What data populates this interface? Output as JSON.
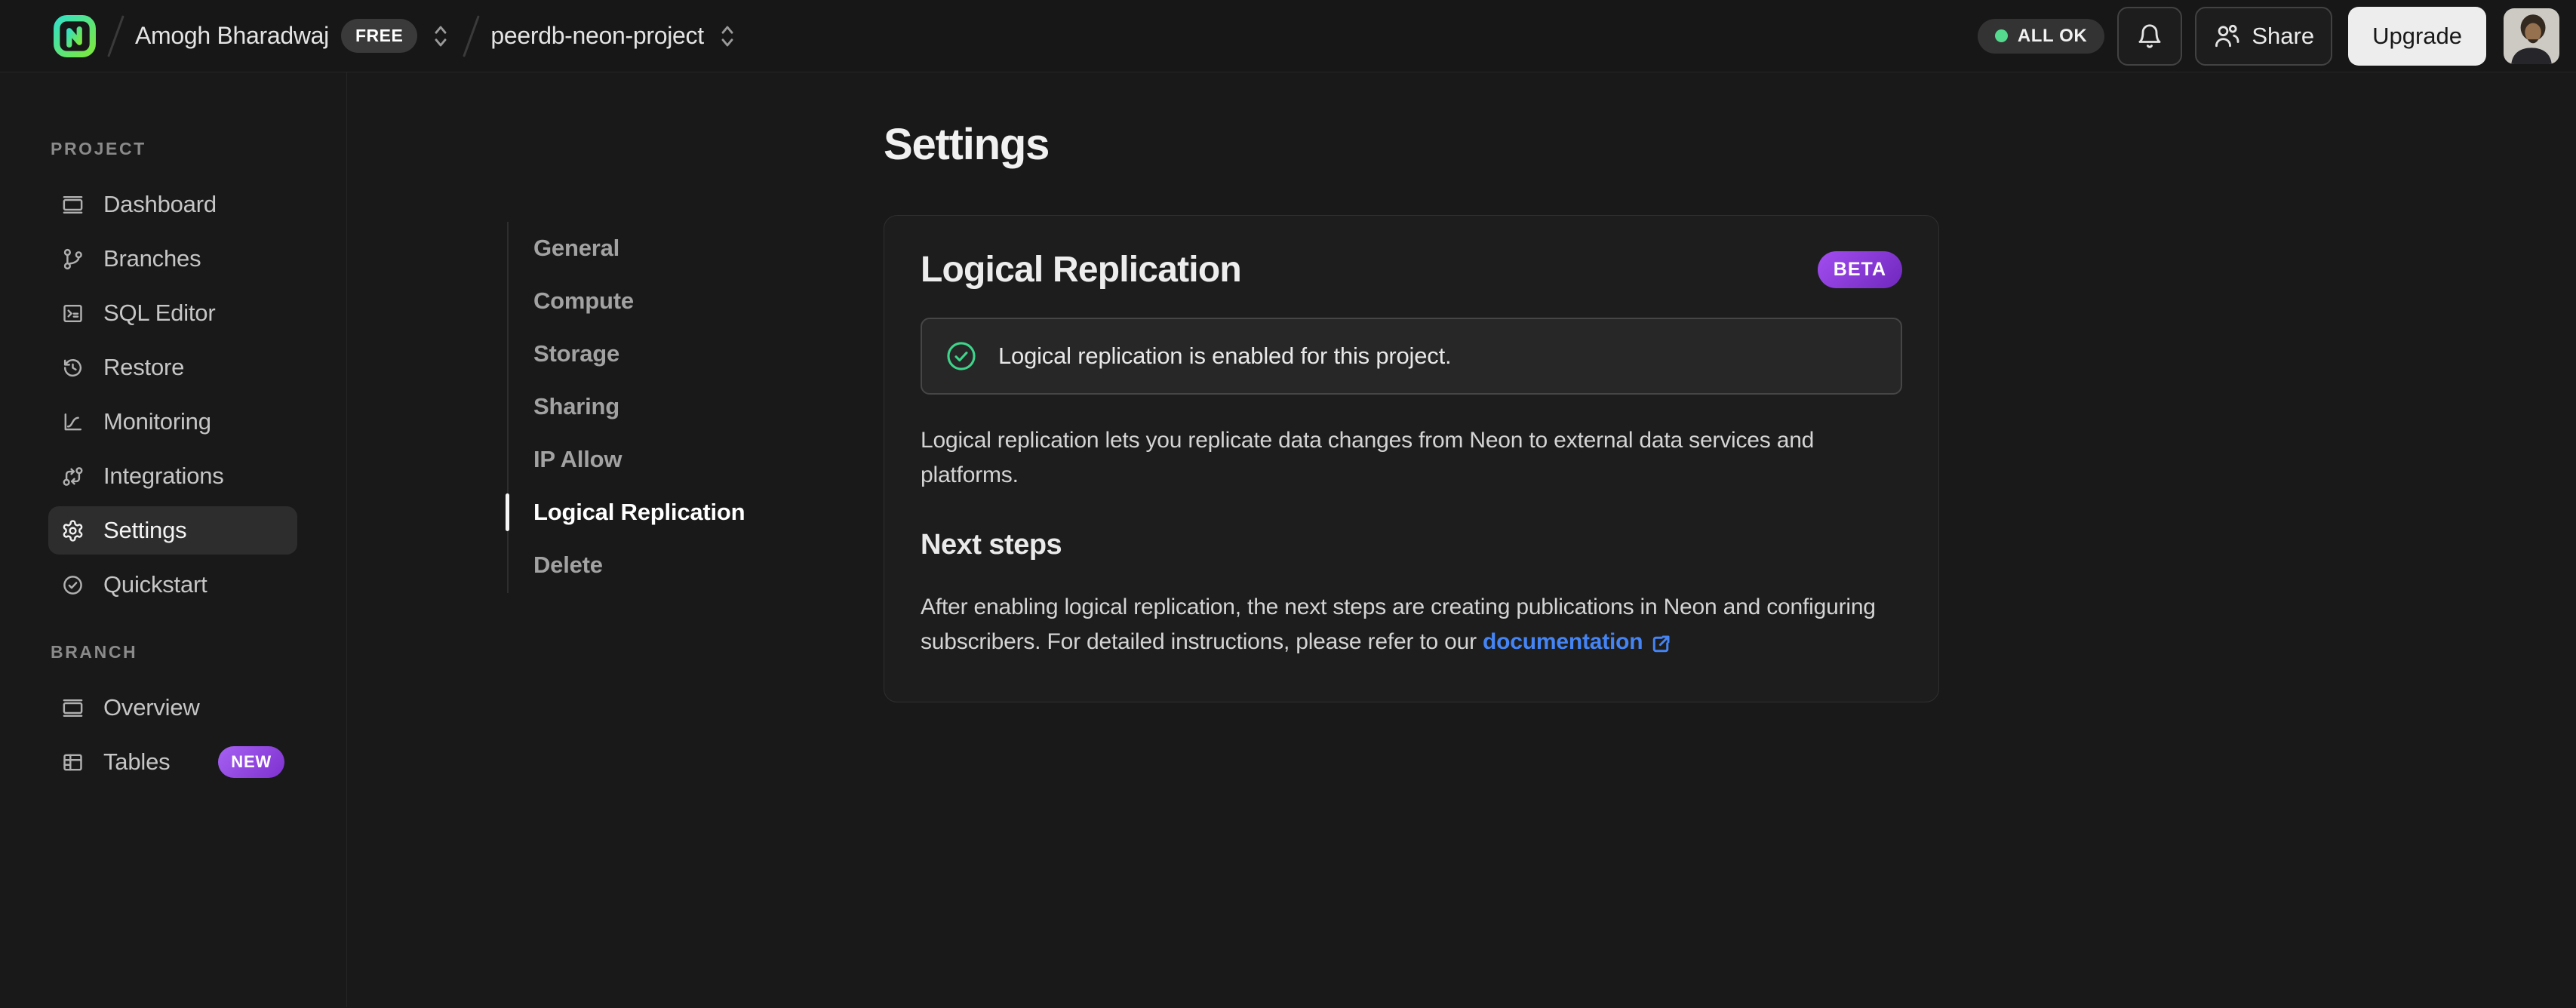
{
  "topbar": {
    "org_name": "Amogh Bharadwaj",
    "org_plan_badge": "FREE",
    "project_name": "peerdb-neon-project",
    "status_badge": "ALL OK",
    "share_label": "Share",
    "upgrade_label": "Upgrade"
  },
  "sidebar": {
    "project_section_label": "PROJECT",
    "branch_section_label": "BRANCH",
    "project_items": [
      {
        "label": "Dashboard",
        "icon": "dashboard-icon"
      },
      {
        "label": "Branches",
        "icon": "git-branch-icon"
      },
      {
        "label": "SQL Editor",
        "icon": "terminal-icon"
      },
      {
        "label": "Restore",
        "icon": "history-icon"
      },
      {
        "label": "Monitoring",
        "icon": "chart-icon"
      },
      {
        "label": "Integrations",
        "icon": "integrations-icon"
      },
      {
        "label": "Settings",
        "icon": "gear-icon",
        "active": true
      },
      {
        "label": "Quickstart",
        "icon": "check-circle-icon"
      }
    ],
    "branch_items": [
      {
        "label": "Overview",
        "icon": "window-icon"
      },
      {
        "label": "Tables",
        "icon": "table-icon",
        "badge": "NEW"
      }
    ]
  },
  "settings_nav": {
    "items": [
      "General",
      "Compute",
      "Storage",
      "Sharing",
      "IP Allow",
      "Logical Replication",
      "Delete"
    ],
    "active": "Logical Replication"
  },
  "main": {
    "page_title": "Settings",
    "card": {
      "title": "Logical Replication",
      "beta_badge": "BETA",
      "alert_text": "Logical replication is enabled for this project.",
      "description": "Logical replication lets you replicate data changes from Neon to external data services and platforms.",
      "next_steps_title": "Next steps",
      "next_steps_text_before_link": "After enabling logical replication, the next steps are creating publications in Neon and configuring subscribers. For detailed instructions, please refer to our ",
      "link_label": "documentation"
    }
  },
  "colors": {
    "accent_green": "#55d98f",
    "badge_purple_start": "#a661f2",
    "badge_purple_end": "#7e30cf",
    "link_blue": "#4584f4",
    "success_icon_green": "#3ed58b"
  }
}
